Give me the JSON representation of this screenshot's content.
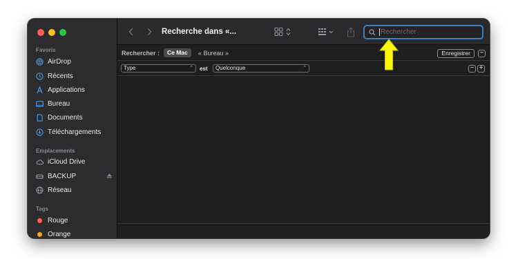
{
  "sidebar": {
    "sections": {
      "favorites": "Favoris",
      "locations": "Emplacements",
      "tags": "Tags"
    },
    "favorites": [
      {
        "label": "AirDrop",
        "icon": "airdrop-icon"
      },
      {
        "label": "Récents",
        "icon": "clock-icon"
      },
      {
        "label": "Applications",
        "icon": "applications-icon"
      },
      {
        "label": "Bureau",
        "icon": "desktop-icon"
      },
      {
        "label": "Documents",
        "icon": "document-icon"
      },
      {
        "label": "Téléchargements",
        "icon": "download-icon"
      }
    ],
    "locations": [
      {
        "label": "iCloud Drive",
        "icon": "cloud-icon"
      },
      {
        "label": "BACKUP",
        "icon": "drive-icon"
      },
      {
        "label": "Réseau",
        "icon": "globe-icon"
      }
    ],
    "tags": [
      {
        "label": "Rouge",
        "color": "#fe5f57"
      },
      {
        "label": "Orange",
        "color": "#f5a623"
      }
    ]
  },
  "toolbar": {
    "title": "Recherche dans «..."
  },
  "search": {
    "placeholder": "Rechercher",
    "value": ""
  },
  "scope": {
    "label": "Rechercher :",
    "selected": "Ce Mac",
    "other": "« Bureau »",
    "save_label": "Enregistrer",
    "minus": "−",
    "plus": "+"
  },
  "criteria": {
    "attribute": "Type",
    "operator": "est",
    "value": "Quelconque"
  },
  "colors": {
    "accent": "#3b82c4",
    "highlight_arrow": "#f7f700",
    "sidebar_icon": "#4a9df0"
  }
}
